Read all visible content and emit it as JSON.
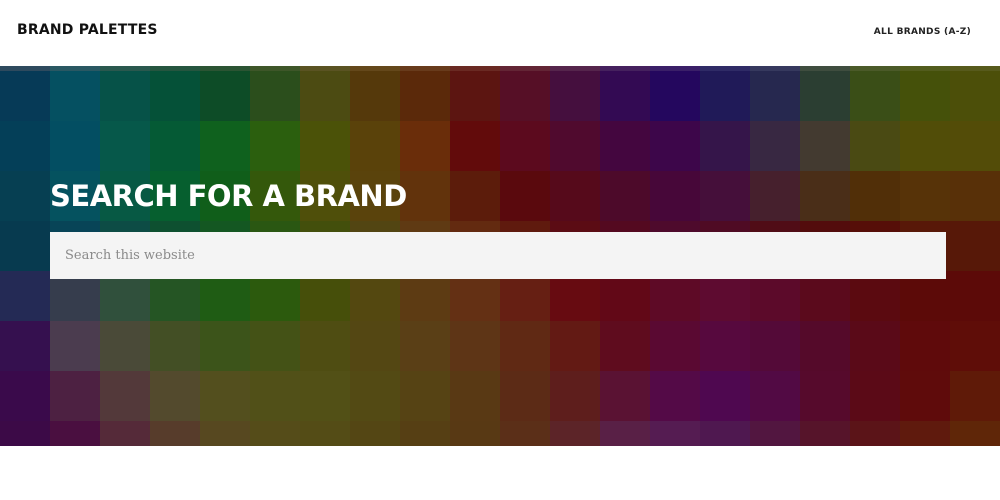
{
  "header": {
    "site_title": "BRAND PALETTES",
    "nav_link": "ALL BRANDS (A-Z)"
  },
  "hero": {
    "title": "SEARCH FOR A BRAND",
    "search": {
      "placeholder": "Search this website",
      "value": ""
    }
  },
  "colors": {
    "header_background": "#ffffff",
    "hero_title": "#ffffff",
    "search_background": "#f4f4f4",
    "mosaic_rows": [
      [
        "#2e4a5e",
        "#2a5863",
        "#2a584e",
        "#25553f",
        "#2b5433",
        "#3e5629",
        "#5a5322",
        "#64481b",
        "#683b1c",
        "#6a2a23",
        "#632535",
        "#55254c",
        "#45215e",
        "#3a1f68",
        "#2f2b66",
        "#36395e",
        "#3f4d3f",
        "#4b5a29",
        "#525c1d",
        "#575a1c"
      ],
      [
        "#063a57",
        "#055061",
        "#065248",
        "#055138",
        "#0d4c27",
        "#2b4e1c",
        "#4c4b12",
        "#55390b",
        "#5b290a",
        "#5c1511",
        "#560f26",
        "#450f3e",
        "#330a53",
        "#24075e",
        "#201a58",
        "#26284f",
        "#2b3e32",
        "#3a4e17",
        "#45510a",
        "#4c4f09"
      ],
      [
        "#043f58",
        "#034e62",
        "#06584a",
        "#055a35",
        "#0f611e",
        "#2b5f0e",
        "#4b5208",
        "#5a420a",
        "#6a2d0a",
        "#620b0b",
        "#5c0a1e",
        "#500a2e",
        "#44063f",
        "#3d064a",
        "#35154a",
        "#382842",
        "#433a30",
        "#4a4a13",
        "#514d08",
        "#534c08"
      ],
      [
        "#063f52",
        "#05525f",
        "#075944",
        "#065f2f",
        "#105e1a",
        "#34580b",
        "#4f4f0a",
        "#5a430c",
        "#62330c",
        "#5c1c0b",
        "#5a090d",
        "#560a1b",
        "#4d0a2a",
        "#470739",
        "#450f3a",
        "#46202d",
        "#4a2e18",
        "#512f08",
        "#573308",
        "#583008"
      ],
      [
        "#073a4f",
        "#084457",
        "#0d4c45",
        "#0e5030",
        "#145722",
        "#2a5712",
        "#434f0c",
        "#524512",
        "#5f3a13",
        "#632a10",
        "#5f1a0e",
        "#5b0c14",
        "#540920",
        "#4e0a2c",
        "#4f0b24",
        "#500c16",
        "#530c0c",
        "#560e08",
        "#581808",
        "#571808"
      ],
      [
        "#242a55",
        "#363d4d",
        "#30503c",
        "#255524",
        "#1f5c14",
        "#2c5a0d",
        "#464f0a",
        "#544810",
        "#5d3b13",
        "#643014",
        "#661f13",
        "#670b11",
        "#620817",
        "#5e0a26",
        "#5e0b30",
        "#5c0a2a",
        "#5b0a1c",
        "#5b0a10",
        "#5c0a08",
        "#5c0a08"
      ],
      [
        "#35104f",
        "#4b3c4f",
        "#4a4a38",
        "#434f25",
        "#3c541a",
        "#445216",
        "#4f4d12",
        "#544713",
        "#5a3f16",
        "#5e3516",
        "#602914",
        "#631a14",
        "#5f0c1e",
        "#5a0932",
        "#57093e",
        "#540a38",
        "#550a2a",
        "#5a0a18",
        "#5f0a0b",
        "#5f0d08"
      ],
      [
        "#3a0a4b",
        "#4d2142",
        "#53393a",
        "#534a2d",
        "#534f1e",
        "#515018",
        "#525016",
        "#534a14",
        "#564314",
        "#593914",
        "#5c2b16",
        "#5e1e1c",
        "#5a1233",
        "#540a47",
        "#4f0850",
        "#520a44",
        "#560a2c",
        "#5b0a17",
        "#5f0b0b",
        "#5f1a08"
      ],
      [
        "#3c0a47",
        "#4a0f40",
        "#552a39",
        "#573c2b",
        "#574820",
        "#554c19",
        "#544c16",
        "#544614",
        "#563f14",
        "#583914",
        "#5b2f18",
        "#5c2428",
        "#592046",
        "#551c52",
        "#4f1850",
        "#521640",
        "#56142a",
        "#5b1418",
        "#5f1a0d",
        "#5f2608"
      ]
    ]
  }
}
